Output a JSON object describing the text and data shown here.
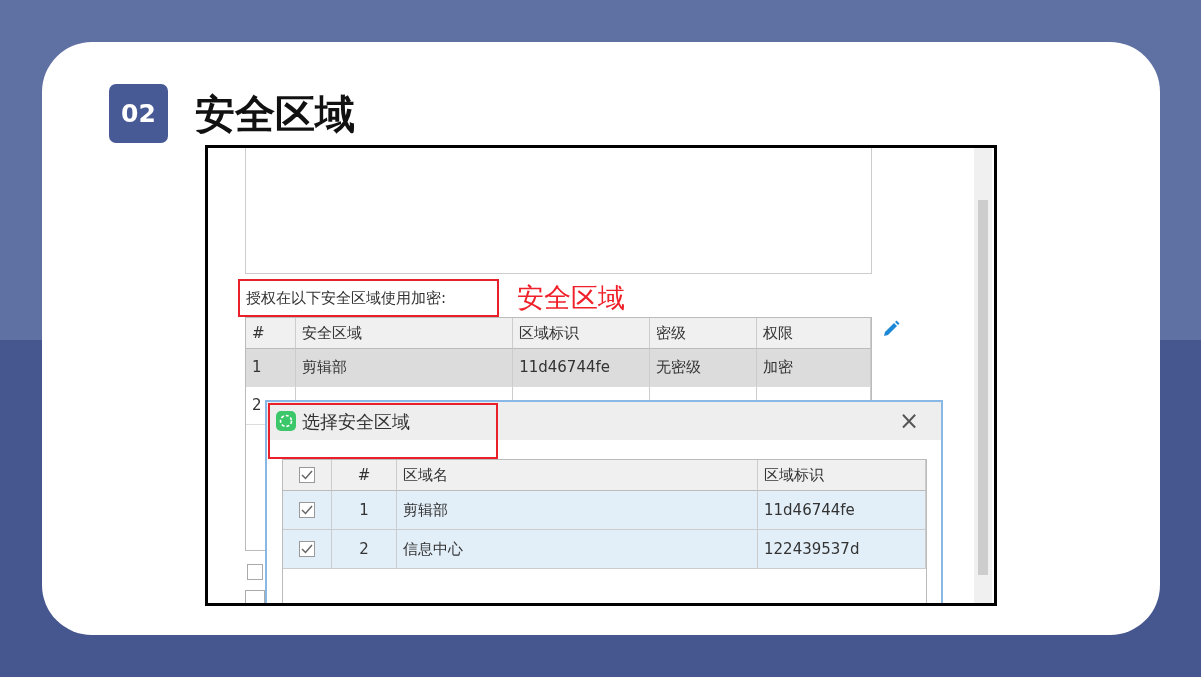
{
  "slide": {
    "number": "02",
    "title": "安全区域"
  },
  "screenshot": {
    "label": "授权在以下安全区域使用加密:",
    "annotation": "安全区域",
    "table": {
      "columns": [
        "#",
        "安全区域",
        "区域标识",
        "密级",
        "权限"
      ],
      "rows": [
        {
          "cells": [
            "1",
            "剪辑部",
            "11d46744fe",
            "无密级",
            "加密"
          ],
          "selected": true
        },
        {
          "cells": [
            "2"
          ],
          "selected": false
        }
      ]
    },
    "option_checkbox": {
      "checked": false
    },
    "dialog": {
      "title": "选择安全区域",
      "close": "×",
      "select_all_checked": true,
      "columns": [
        "#",
        "区域名",
        "区域标识"
      ],
      "rows": [
        {
          "checked": true,
          "cells": [
            "1",
            "剪辑部",
            "11d46744fe"
          ]
        },
        {
          "checked": true,
          "cells": [
            "2",
            "信息中心",
            "122439537d"
          ]
        }
      ]
    }
  }
}
